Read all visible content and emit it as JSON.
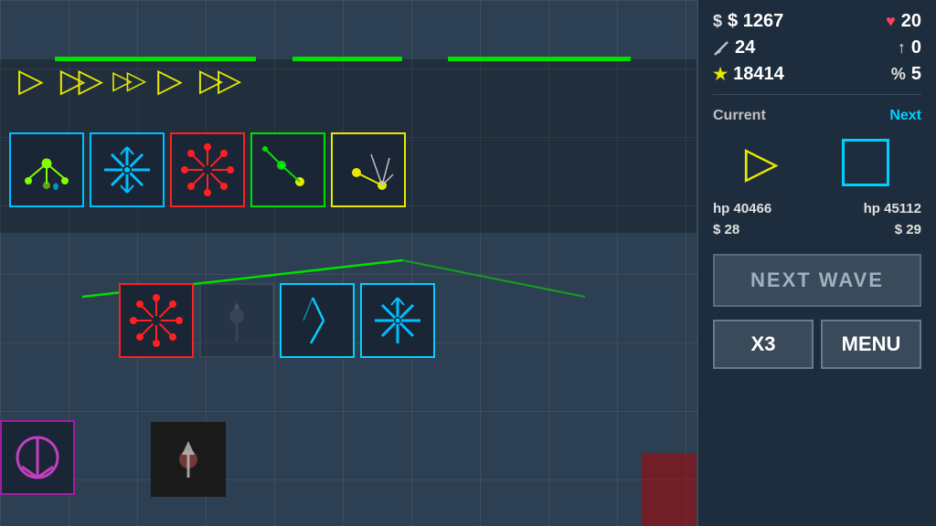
{
  "stats": {
    "money": "$ 1267",
    "hearts": "20",
    "sword": "24",
    "up": "0",
    "star": "18414",
    "percent": "5",
    "current_label": "Current",
    "next_label": "Next",
    "current_hp_label": "hp 40466",
    "next_hp_label": "hp 45112",
    "current_cost": "$ 28",
    "next_cost": "$ 29"
  },
  "buttons": {
    "next_wave": "NEXT WAVE",
    "x3": "X3",
    "menu": "MENU"
  },
  "icons": {
    "money": "$",
    "heart": "♥",
    "sword": "⚔",
    "up_arrow": "↑",
    "star": "★",
    "percent": "%"
  }
}
